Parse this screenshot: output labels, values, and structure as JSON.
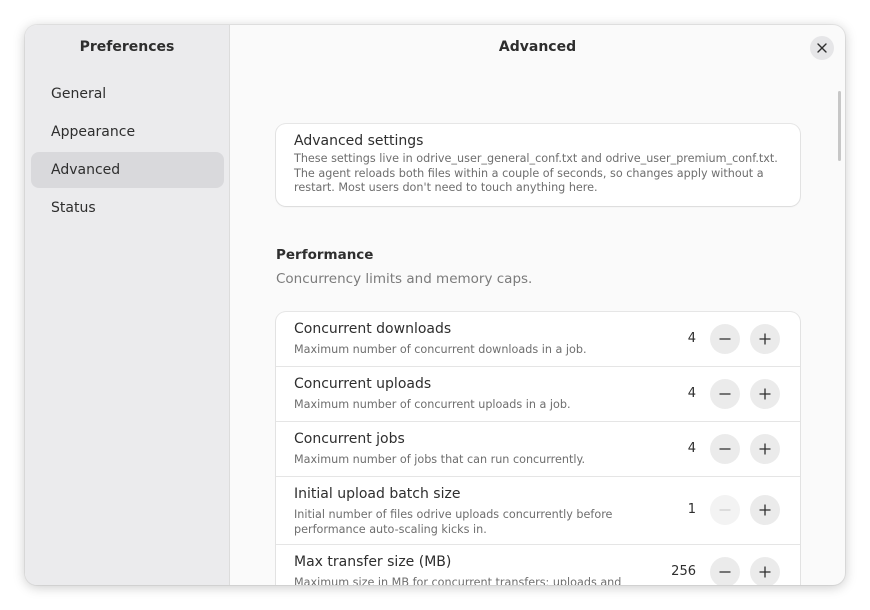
{
  "sidebar": {
    "title": "Preferences",
    "items": [
      {
        "label": "General"
      },
      {
        "label": "Appearance"
      },
      {
        "label": "Advanced"
      },
      {
        "label": "Status"
      }
    ],
    "active_index": 2
  },
  "main": {
    "title": "Advanced",
    "close_icon": "close-icon"
  },
  "info": {
    "title": "Advanced settings",
    "body": "These settings live in odrive_user_general_conf.txt and odrive_user_premium_conf.txt. The agent reloads both files within a couple of seconds, so changes apply without a restart. Most users don't need to touch anything here."
  },
  "performance": {
    "title": "Performance",
    "subtitle": "Concurrency limits and memory caps.",
    "rows": [
      {
        "label": "Concurrent downloads",
        "desc": "Maximum number of concurrent downloads in a job.",
        "value": "4",
        "minus_enabled": true
      },
      {
        "label": "Concurrent uploads",
        "desc": "Maximum number of concurrent uploads in a job.",
        "value": "4",
        "minus_enabled": true
      },
      {
        "label": "Concurrent jobs",
        "desc": "Maximum number of jobs that can run concurrently.",
        "value": "4",
        "minus_enabled": true
      },
      {
        "label": "Initial upload batch size",
        "desc": "Initial number of files odrive uploads concurrently before performance auto-scaling kicks in.",
        "value": "1",
        "minus_enabled": false
      },
      {
        "label": "Max transfer size (MB)",
        "desc": "Maximum size in MB for concurrent transfers; uploads and",
        "value": "256",
        "minus_enabled": true
      }
    ]
  },
  "colors": {
    "sidebar_bg": "#ebebed",
    "active_item_bg": "#d9d9dc",
    "content_bg": "#fafafa",
    "card_bg": "#ffffff"
  }
}
